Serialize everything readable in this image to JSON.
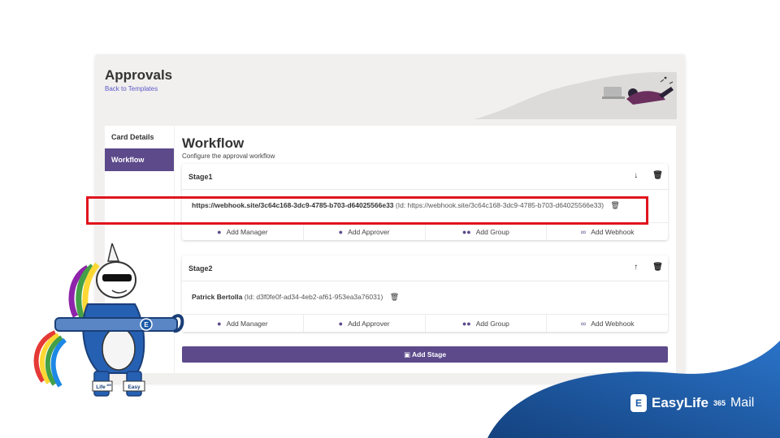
{
  "app": {
    "title": "Approvals",
    "back_link": "Back to Templates"
  },
  "nav": {
    "items": [
      {
        "label": "Card Details"
      },
      {
        "label": "Workflow"
      }
    ]
  },
  "workflow": {
    "title": "Workflow",
    "subtitle": "Configure the approval workflow"
  },
  "stages": [
    {
      "name": "Stage1",
      "member_name": "https://webhook.site/3c64c168-3dc9-4785-b703-d64025566e33",
      "member_id": "(Id: https://webhook.site/3c64c168-3dc9-4785-b703-d64025566e33)"
    },
    {
      "name": "Stage2",
      "member_name": "Patrick Bertolla",
      "member_id": "(Id: d3f0fe0f-ad34-4eb2-af61-953ea3a76031)"
    }
  ],
  "actions": {
    "add_manager": "Add Manager",
    "add_approver": "Add Approver",
    "add_group": "Add Group",
    "add_webhook": "Add Webhook"
  },
  "add_stage": "Add Stage",
  "brand": {
    "name": "EasyLife",
    "sup": "365",
    "suffix": "Mail",
    "logo_letter": "E"
  },
  "mascot": {
    "badge_letter": "E",
    "sleeve_left": "Life",
    "sleeve_left_sup": "365",
    "sleeve_right": "Easy"
  },
  "colors": {
    "accent": "#5c4a8a",
    "highlight": "#e0141c",
    "brand_blue": "#1d5ba8"
  }
}
